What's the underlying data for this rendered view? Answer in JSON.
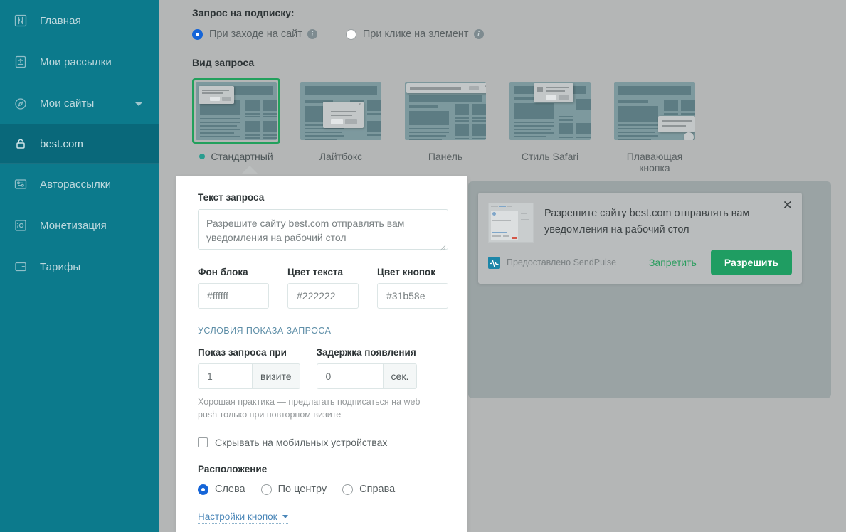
{
  "sidebar": {
    "items": [
      {
        "label": "Главная",
        "icon": "dashboard-icon"
      },
      {
        "label": "Мои рассылки",
        "icon": "campaigns-icon"
      },
      {
        "label": "Мои сайты",
        "icon": "sites-icon",
        "expanded": true
      },
      {
        "label": "Авторассылки",
        "icon": "automation-icon"
      },
      {
        "label": "Монетизация",
        "icon": "monetization-icon"
      },
      {
        "label": "Тарифы",
        "icon": "pricing-icon"
      }
    ],
    "sub_item": {
      "label": "best.com",
      "icon": "unlock-icon"
    }
  },
  "main": {
    "request_section_title": "Запрос на подписку:",
    "trigger_options": [
      {
        "label": "При заходе на сайт",
        "selected": true
      },
      {
        "label": "При клике на элемент",
        "selected": false
      }
    ],
    "view_section_title": "Вид запроса",
    "templates": [
      {
        "label": "Стандартный",
        "selected": true
      },
      {
        "label": "Лайтбокс",
        "selected": false
      },
      {
        "label": "Панель",
        "selected": false
      },
      {
        "label": "Стиль Safari",
        "selected": false
      },
      {
        "label": "Плавающая кнопка",
        "selected": false
      }
    ]
  },
  "form": {
    "text_label": "Текст запроса",
    "text_value": "Разрешите сайту best.com отправлять вам уведомления на рабочий стол",
    "colors": [
      {
        "label": "Фон блока",
        "value": "#ffffff"
      },
      {
        "label": "Цвет текста",
        "value": "#222222"
      },
      {
        "label": "Цвет кнопок",
        "value": "#31b58e"
      }
    ],
    "conditions_title": "УСЛОВИЯ ПОКАЗА ЗАПРОСА",
    "visit_label": "Показ запроса при",
    "visit_value": "1",
    "visit_suffix": "визите",
    "delay_label": "Задержка появления",
    "delay_value": "0",
    "delay_suffix": "сек.",
    "hint": "Хорошая практика — предлагать подписаться на web push только при повторном визите",
    "hide_mobile_label": "Скрывать на мобильных устройствах",
    "hide_mobile_checked": false,
    "position_label": "Расположение",
    "position_options": [
      {
        "label": "Слева",
        "selected": true
      },
      {
        "label": "По центру",
        "selected": false
      },
      {
        "label": "Справа",
        "selected": false
      }
    ],
    "buttons_link": "Настройки кнопок"
  },
  "preview": {
    "message": "Разрешите сайту best.com отправлять вам уведомления на рабочий стол",
    "provided_by": "Предоставлено SendPulse",
    "deny_label": "Запретить",
    "allow_label": "Разрешить",
    "close_icon": "✕",
    "accent_color": "#1f9d62"
  }
}
